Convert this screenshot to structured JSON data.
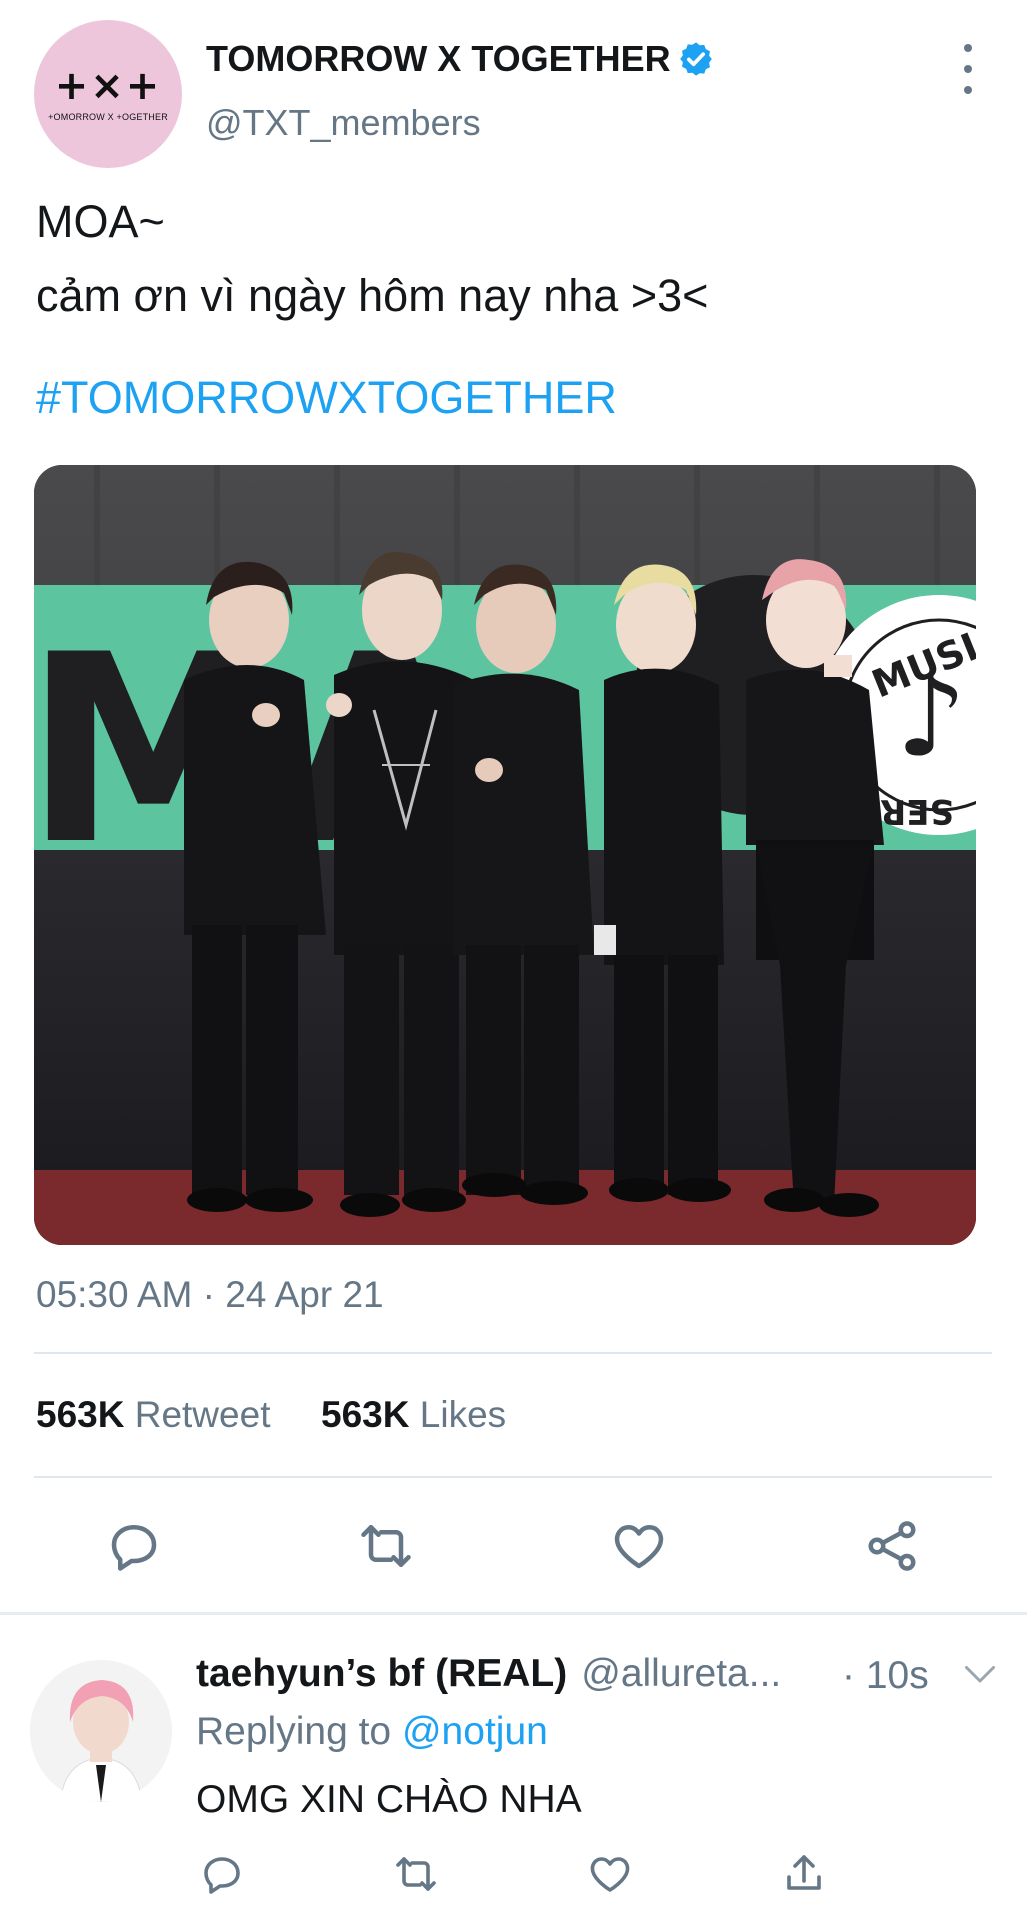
{
  "tweet": {
    "author": {
      "display_name": "TOMORROW X TOGETHER",
      "handle": "@TXT_members",
      "avatar_logo": "+×+",
      "avatar_subtext": "+OMORROW X +OGETHER",
      "verified": true
    },
    "text_lines": [
      "MOA~",
      "cảm ơn vì ngày hôm nay nha >3<"
    ],
    "hashtag": "#TOMORROWXTOGETHER",
    "photo": {
      "backdrop_text": "MA",
      "badge_text_top": "MUSIC",
      "badge_text_bottom": "SER"
    },
    "timestamp": "05:30 AM · 24 Apr 21",
    "stats": {
      "retweets_count": "563K",
      "retweets_label": "Retweet",
      "likes_count": "563K",
      "likes_label": "Likes"
    },
    "actions": [
      "reply-icon",
      "retweet-icon",
      "like-icon",
      "share-icon"
    ]
  },
  "reply": {
    "display_name": "taehyun’s bf (REAL)",
    "handle": "@allureta...",
    "time": "· 10s",
    "replying_prefix": "Replying to",
    "replying_to": "@notjun",
    "text": "OMG XIN CHÀO NHA",
    "actions": [
      "reply-icon",
      "retweet-icon",
      "like-icon",
      "share-icon"
    ]
  },
  "colors": {
    "accent": "#1da1f2",
    "secondary_text": "#657786",
    "primary_text": "#14171a",
    "divider": "#e1e8ed",
    "avatar_bg": "#eec6dc",
    "backdrop_green": "#5cc5a0",
    "carpet_red": "#7a2a2c"
  }
}
